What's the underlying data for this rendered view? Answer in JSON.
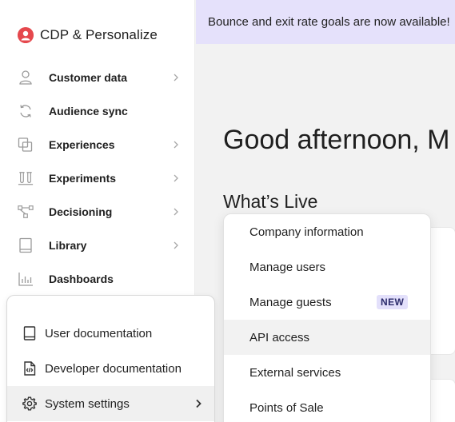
{
  "app": {
    "title": "CDP & Personalize"
  },
  "sidebar": {
    "items": [
      {
        "label": "Customer data",
        "icon": "person-icon",
        "has_submenu": true
      },
      {
        "label": "Audience sync",
        "icon": "sync-icon",
        "has_submenu": false
      },
      {
        "label": "Experiences",
        "icon": "experiences-icon",
        "has_submenu": true
      },
      {
        "label": "Experiments",
        "icon": "flask-icon",
        "has_submenu": true
      },
      {
        "label": "Decisioning",
        "icon": "flow-icon",
        "has_submenu": true
      },
      {
        "label": "Library",
        "icon": "book-icon",
        "has_submenu": true
      },
      {
        "label": "Dashboards",
        "icon": "bar-chart-icon",
        "has_submenu": false
      }
    ]
  },
  "banner": {
    "text": "Bounce and exit rate goals are now available!"
  },
  "main": {
    "greeting": "Good afternoon, M",
    "section_title": "What’s Live"
  },
  "help_menu": {
    "items": [
      {
        "label": "User documentation",
        "icon": "book-icon"
      },
      {
        "label": "Developer documentation",
        "icon": "code-file-icon"
      },
      {
        "label": "System settings",
        "icon": "gear-icon",
        "active": true
      }
    ]
  },
  "settings_submenu": {
    "items": [
      {
        "label": "Company information"
      },
      {
        "label": "Manage users"
      },
      {
        "label": "Manage guests",
        "badge": "NEW"
      },
      {
        "label": "API access",
        "hover": true
      },
      {
        "label": "External services"
      },
      {
        "label": "Points of Sale"
      }
    ]
  },
  "colors": {
    "banner_bg": "#e5e1fb",
    "brand_red": "#e5484d",
    "badge_bg": "#e3e0fb",
    "page_bg": "#f2f2f2"
  }
}
